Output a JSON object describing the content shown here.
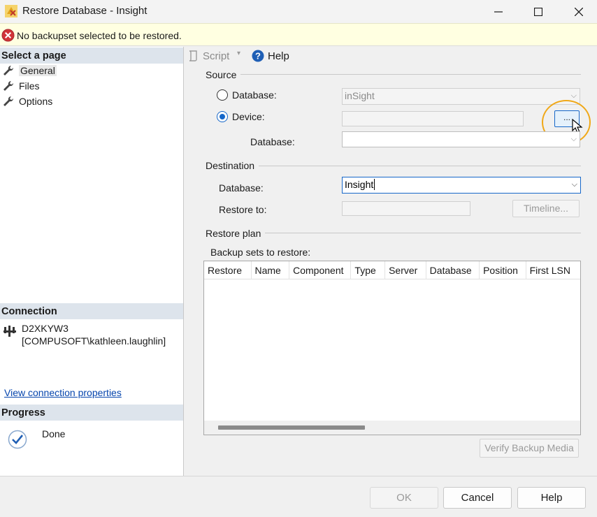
{
  "window": {
    "title": "Restore Database - Insight"
  },
  "error": {
    "message": "No backupset selected to be restored."
  },
  "left_pane": {
    "select_page_header": "Select a page",
    "pages": [
      {
        "label": "General"
      },
      {
        "label": "Files"
      },
      {
        "label": "Options"
      }
    ],
    "connection_header": "Connection",
    "connection_server": "D2XKYW3",
    "connection_user": "[COMPUSOFT\\kathleen.laughlin]",
    "view_connection_link": "View connection properties",
    "progress_header": "Progress",
    "progress_status": "Done"
  },
  "toolbar": {
    "script_label": "Script",
    "help_label": "Help"
  },
  "source": {
    "group_label": "Source",
    "database_radio_label": "Database:",
    "database_value": "inSight",
    "device_radio_label": "Device:",
    "device_value": "",
    "browse_label": "...",
    "device_database_label": "Database:",
    "device_database_value": "",
    "selected": "device"
  },
  "destination": {
    "group_label": "Destination",
    "database_label": "Database:",
    "database_value": "Insight",
    "restore_to_label": "Restore to:",
    "restore_to_value": "",
    "timeline_label": "Timeline..."
  },
  "restore_plan": {
    "group_label": "Restore plan",
    "backup_sets_label": "Backup sets to restore:",
    "columns": [
      "Restore",
      "Name",
      "Component",
      "Type",
      "Server",
      "Database",
      "Position",
      "First LSN"
    ],
    "rows": []
  },
  "verify_label": "Verify Backup Media",
  "buttons": {
    "ok": "OK",
    "cancel": "Cancel",
    "help": "Help"
  }
}
